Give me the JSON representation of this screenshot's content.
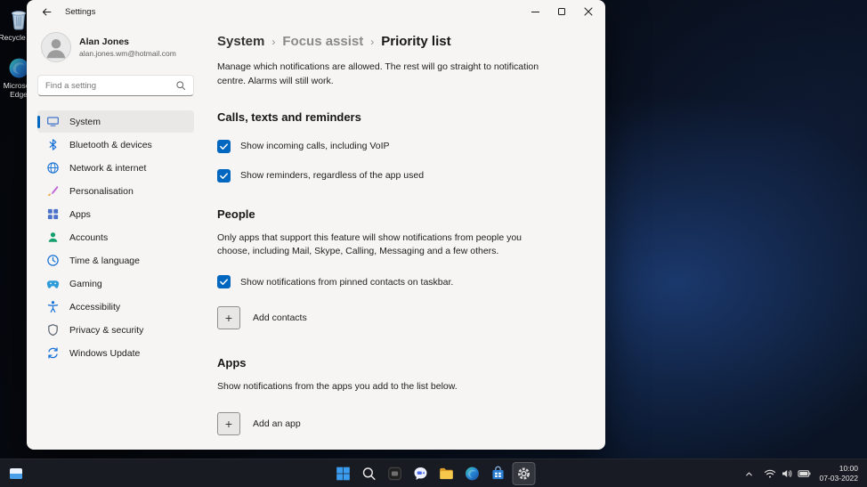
{
  "titlebar": {
    "title": "Settings"
  },
  "desktop": {
    "icons": [
      {
        "label": "Recycle Bin"
      },
      {
        "label": "Microsoft Edge"
      }
    ]
  },
  "sidebar": {
    "user": {
      "name": "Alan Jones",
      "email": "alan.jones.wm@hotmail.com"
    },
    "search_placeholder": "Find a setting",
    "items": [
      {
        "label": "System",
        "selected": true
      },
      {
        "label": "Bluetooth & devices"
      },
      {
        "label": "Network & internet"
      },
      {
        "label": "Personalisation"
      },
      {
        "label": "Apps"
      },
      {
        "label": "Accounts"
      },
      {
        "label": "Time & language"
      },
      {
        "label": "Gaming"
      },
      {
        "label": "Accessibility"
      },
      {
        "label": "Privacy & security"
      },
      {
        "label": "Windows Update"
      }
    ]
  },
  "content": {
    "breadcrumb": [
      "System",
      "Focus assist",
      "Priority list"
    ],
    "separator": "›",
    "intro": "Manage which notifications are allowed. The rest will go straight to notification centre. Alarms will still work.",
    "calls": {
      "title": "Calls, texts and reminders",
      "items": [
        {
          "label": "Show incoming calls, including VoIP",
          "checked": true
        },
        {
          "label": "Show reminders, regardless of the app used",
          "checked": true
        }
      ]
    },
    "people": {
      "title": "People",
      "description": "Only apps that support this feature will show notifications from people you choose, including Mail, Skype, Calling, Messaging and a few others.",
      "items": [
        {
          "label": "Show notifications from pinned contacts on taskbar.",
          "checked": true
        }
      ],
      "add_label": "Add contacts"
    },
    "apps": {
      "title": "Apps",
      "description": "Show notifications from the apps you add to the list below.",
      "add_label": "Add an app"
    }
  },
  "glyphs": {
    "plus": "+"
  },
  "taskbar": {
    "time": "10:00",
    "date": "07-03-2022"
  },
  "colors": {
    "accent": "#0067c0",
    "checkbox_fill": "#0067c0"
  }
}
